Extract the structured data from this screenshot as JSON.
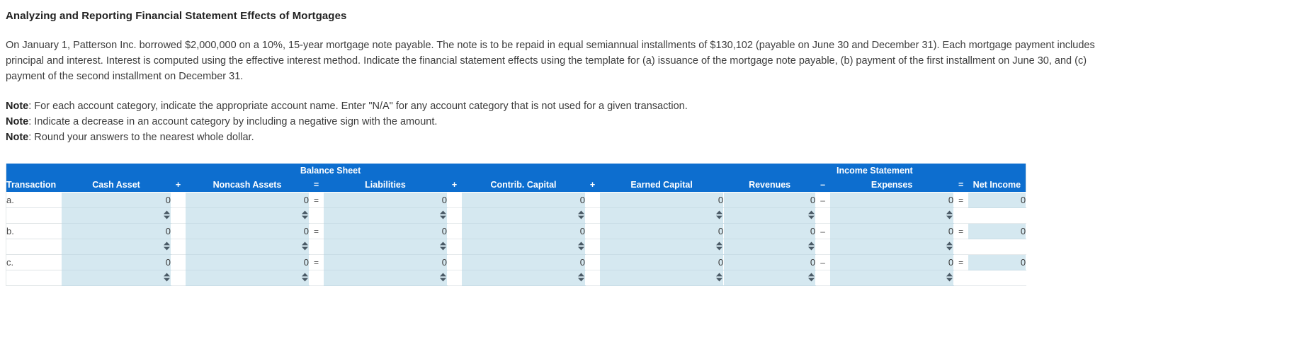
{
  "title": "Analyzing and Reporting Financial Statement Effects of Mortgages",
  "paragraph": "On January 1, Patterson Inc. borrowed $2,000,000 on a 10%, 15-year mortgage note payable. The note is to be repaid in equal semiannual installments of $130,102 (payable on June 30 and December 31). Each mortgage payment includes principal and interest. Interest is computed using the effective interest method. Indicate the financial statement effects using the template for (a) issuance of the mortgage note payable, (b) payment of the first installment on June 30, and (c) payment of the second installment on December 31.",
  "notes": [
    {
      "label": "Note",
      "text": ": For each account category, indicate the appropriate account name. Enter \"N/A\" for any account category that is not used for a given transaction."
    },
    {
      "label": "Note",
      "text": ": Indicate a decrease in an account category by including a negative sign with the amount."
    },
    {
      "label": "Note",
      "text": ": Round your answers to the nearest whole dollar."
    }
  ],
  "table": {
    "group_headers": {
      "balance_sheet": "Balance Sheet",
      "income_statement": "Income Statement"
    },
    "columns": [
      {
        "key": "transaction",
        "label": "Transaction",
        "type": "txn"
      },
      {
        "key": "cash_asset",
        "label": "Cash Asset",
        "type": "val"
      },
      {
        "key": "op_plus_1",
        "label": "+",
        "type": "op"
      },
      {
        "key": "noncash_assets",
        "label": "Noncash Assets",
        "type": "val"
      },
      {
        "key": "op_eq_1",
        "label": "=",
        "type": "op"
      },
      {
        "key": "liabilities",
        "label": "Liabilities",
        "type": "val"
      },
      {
        "key": "op_plus_2",
        "label": "+",
        "type": "op"
      },
      {
        "key": "contrib_capital",
        "label": "Contrib. Capital",
        "type": "val"
      },
      {
        "key": "op_plus_3",
        "label": "+",
        "type": "op"
      },
      {
        "key": "earned_capital",
        "label": "Earned Capital",
        "type": "val"
      },
      {
        "key": "revenues",
        "label": "Revenues",
        "type": "val"
      },
      {
        "key": "op_minus",
        "label": "–",
        "type": "op"
      },
      {
        "key": "expenses",
        "label": "Expenses",
        "type": "val"
      },
      {
        "key": "op_eq_2",
        "label": "=",
        "type": "op"
      },
      {
        "key": "net_income",
        "label": "Net Income",
        "type": "val"
      }
    ],
    "rows": [
      {
        "kind": "amounts",
        "transaction": "a.",
        "cash_asset": "0",
        "op_plus_1": "",
        "noncash_assets": "0",
        "op_eq_1": "=",
        "liabilities": "0",
        "op_plus_2": "",
        "contrib_capital": "0",
        "op_plus_3": "",
        "earned_capital": "0",
        "revenues": "0",
        "op_minus": "–",
        "expenses": "0",
        "op_eq_2": "=",
        "net_income": "0"
      },
      {
        "kind": "selects",
        "transaction": "",
        "cash_asset": "",
        "op_plus_1": "",
        "noncash_assets": "",
        "op_eq_1": "",
        "liabilities": "",
        "op_plus_2": "",
        "contrib_capital": "",
        "op_plus_3": "",
        "earned_capital": "",
        "revenues": "",
        "op_minus": "",
        "expenses": "",
        "op_eq_2": "",
        "net_income": ""
      },
      {
        "kind": "amounts",
        "transaction": "b.",
        "cash_asset": "0",
        "op_plus_1": "",
        "noncash_assets": "0",
        "op_eq_1": "=",
        "liabilities": "0",
        "op_plus_2": "",
        "contrib_capital": "0",
        "op_plus_3": "",
        "earned_capital": "0",
        "revenues": "0",
        "op_minus": "–",
        "expenses": "0",
        "op_eq_2": "=",
        "net_income": "0"
      },
      {
        "kind": "selects",
        "transaction": "",
        "cash_asset": "",
        "op_plus_1": "",
        "noncash_assets": "",
        "op_eq_1": "",
        "liabilities": "",
        "op_plus_2": "",
        "contrib_capital": "",
        "op_plus_3": "",
        "earned_capital": "",
        "revenues": "",
        "op_minus": "",
        "expenses": "",
        "op_eq_2": "",
        "net_income": ""
      },
      {
        "kind": "amounts",
        "transaction": "c.",
        "cash_asset": "0",
        "op_plus_1": "",
        "noncash_assets": "0",
        "op_eq_1": "=",
        "liabilities": "0",
        "op_plus_2": "",
        "contrib_capital": "0",
        "op_plus_3": "",
        "earned_capital": "0",
        "revenues": "0",
        "op_minus": "–",
        "expenses": "0",
        "op_eq_2": "=",
        "net_income": "0"
      },
      {
        "kind": "selects",
        "transaction": "",
        "cash_asset": "",
        "op_plus_1": "",
        "noncash_assets": "",
        "op_eq_1": "",
        "liabilities": "",
        "op_plus_2": "",
        "contrib_capital": "",
        "op_plus_3": "",
        "earned_capital": "",
        "revenues": "",
        "op_minus": "",
        "expenses": "",
        "op_eq_2": "",
        "net_income": ""
      }
    ],
    "select_icon": "spinner-updown-icon",
    "colors": {
      "header_blue": "#0d6ecf",
      "cell_fill": "#d5e8f0",
      "text": "#3a3a3a"
    }
  }
}
